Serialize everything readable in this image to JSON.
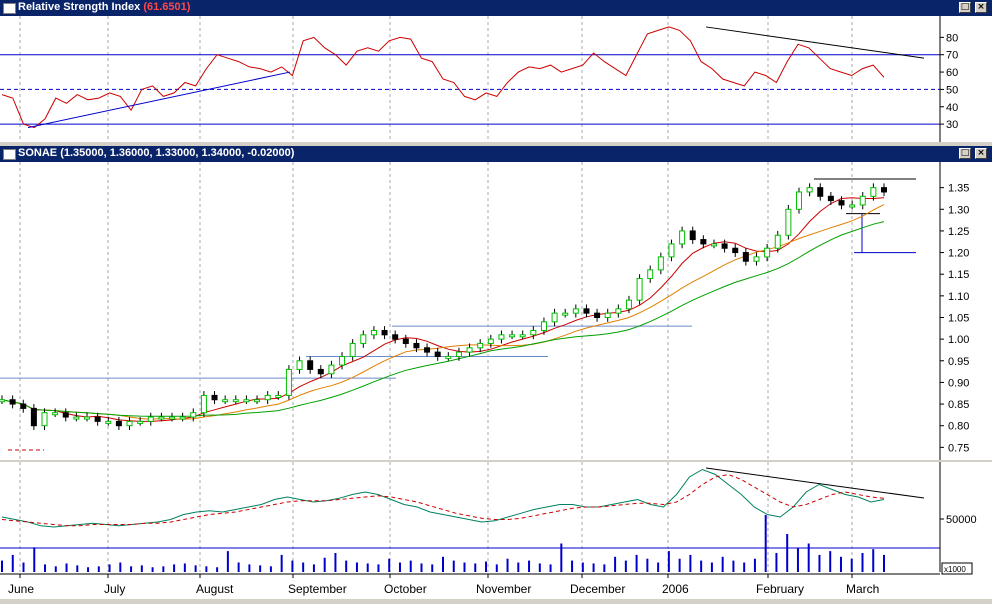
{
  "rsi_panel": {
    "title": "Relative Strength Index",
    "value": "(61.6501)",
    "ticks": [
      "80",
      "70",
      "60",
      "50",
      "40",
      "30"
    ]
  },
  "price_panel": {
    "title": "SONAE",
    "ohlc": "(1.35000, 1.36000, 1.33000, 1.34000, -0.02000)",
    "ticks": [
      "1.35",
      "1.30",
      "1.25",
      "1.20",
      "1.15",
      "1.10",
      "1.05",
      "1.00",
      "0.95",
      "0.90",
      "0.85",
      "0.80",
      "0.75"
    ]
  },
  "volume_panel": {
    "tick": "50000",
    "unit": "x1000"
  },
  "x_axis": {
    "months": [
      "June",
      "July",
      "August",
      "September",
      "October",
      "November",
      "December",
      "2006",
      "February",
      "March"
    ]
  },
  "colors": {
    "rsi_line": "#cc0000",
    "candle_up": "#00c000",
    "candle_down": "#000000",
    "ma_short": "#cc0000",
    "ma_mid": "#e08000",
    "ma_long": "#00a000",
    "volume": "#0000cc",
    "osc_fast": "#008060",
    "osc_slow": "#cc0000",
    "trendline_rsi_support": "#0000cc",
    "title_bar": "#0a246a"
  },
  "chart_data": [
    {
      "type": "line",
      "name": "rsi",
      "title": "Relative Strength Index",
      "value_label": "61.6501",
      "ylim": [
        22,
        90
      ],
      "reference_lines": [
        70,
        50,
        30
      ],
      "x": [
        "June",
        "July",
        "August",
        "September",
        "October",
        "November",
        "December",
        "2006",
        "February",
        "March"
      ],
      "series": [
        {
          "values": [
            47,
            45,
            30,
            28,
            33,
            45,
            42,
            47,
            44,
            45,
            48,
            46,
            38,
            50,
            52,
            46,
            48,
            54,
            52,
            62,
            70,
            68,
            66,
            63,
            62,
            60,
            63,
            58,
            78,
            80,
            74,
            70,
            64,
            72,
            74,
            72,
            78,
            80,
            79,
            68,
            66,
            56,
            54,
            46,
            44,
            48,
            46,
            54,
            60,
            63,
            62,
            64,
            60,
            62,
            64,
            71,
            66,
            62,
            58,
            70,
            82,
            84,
            86,
            84,
            78,
            66,
            62,
            56,
            54,
            52,
            60,
            58,
            54,
            66,
            76,
            74,
            68,
            62,
            60,
            58,
            62,
            64,
            57
          ]
        }
      ]
    },
    {
      "type": "line",
      "name": "price",
      "title": "SONAE",
      "value_label": "(1.35000, 1.36000, 1.33000, 1.34000, -0.02000)",
      "ylim": [
        0.73,
        1.4
      ],
      "x": [
        "June",
        "July",
        "August",
        "September",
        "October",
        "November",
        "December",
        "2006",
        "February",
        "March"
      ],
      "series": [
        {
          "values": [
            0.86,
            0.85,
            0.84,
            0.8,
            0.83,
            0.83,
            0.82,
            0.82,
            0.82,
            0.81,
            0.81,
            0.8,
            0.81,
            0.81,
            0.82,
            0.82,
            0.82,
            0.82,
            0.83,
            0.87,
            0.86,
            0.86,
            0.86,
            0.86,
            0.86,
            0.87,
            0.87,
            0.93,
            0.95,
            0.93,
            0.92,
            0.94,
            0.96,
            0.99,
            1.01,
            1.02,
            1.01,
            1.0,
            0.99,
            0.98,
            0.97,
            0.96,
            0.96,
            0.97,
            0.98,
            0.99,
            1.0,
            1.01,
            1.01,
            1.01,
            1.02,
            1.04,
            1.06,
            1.06,
            1.07,
            1.06,
            1.05,
            1.06,
            1.07,
            1.09,
            1.14,
            1.16,
            1.19,
            1.22,
            1.25,
            1.23,
            1.22,
            1.22,
            1.21,
            1.2,
            1.18,
            1.19,
            1.21,
            1.24,
            1.3,
            1.34,
            1.35,
            1.33,
            1.32,
            1.31,
            1.31,
            1.33,
            1.35,
            1.34
          ]
        }
      ],
      "horizontal_lines": [
        0.91,
        0.96,
        1.03,
        1.37,
        1.2
      ]
    },
    {
      "type": "bar",
      "name": "volume",
      "ytick": "50000",
      "unit": "x1000",
      "series": [
        {
          "values": [
            12,
            18,
            10,
            26,
            8,
            6,
            9,
            7,
            5,
            6,
            8,
            10,
            6,
            7,
            5,
            6,
            8,
            9,
            7,
            6,
            5,
            22,
            10,
            8,
            7,
            6,
            18,
            12,
            10,
            8,
            15,
            20,
            12,
            10,
            9,
            8,
            14,
            10,
            12,
            9,
            8,
            16,
            12,
            10,
            9,
            11,
            8,
            14,
            10,
            12,
            9,
            8,
            30,
            12,
            10,
            9,
            8,
            16,
            12,
            18,
            14,
            10,
            22,
            14,
            18,
            12,
            10,
            16,
            12,
            10,
            14,
            60,
            20,
            40,
            25,
            30,
            18,
            22,
            16,
            14,
            20,
            24,
            18
          ]
        }
      ]
    },
    {
      "type": "line",
      "name": "volume_oscillator",
      "series": [
        {
          "values": [
            52,
            50,
            48,
            45,
            44,
            45,
            46,
            47,
            46,
            45,
            46,
            47,
            48,
            50,
            54,
            56,
            57,
            56,
            58,
            60,
            62,
            66,
            68,
            66,
            64,
            65,
            67,
            70,
            72,
            70,
            66,
            62,
            60,
            56,
            54,
            52,
            50,
            48,
            49,
            52,
            55,
            58,
            60,
            62,
            62,
            60,
            60,
            62,
            64,
            66,
            62,
            60,
            70,
            84,
            90,
            86,
            78,
            70,
            60,
            54,
            52,
            60,
            72,
            78,
            74,
            70,
            68,
            64,
            66
          ]
        },
        {
          "values": [
            50,
            49,
            48,
            47,
            46,
            45,
            45,
            46,
            46,
            46,
            46,
            47,
            47,
            48,
            50,
            52,
            54,
            55,
            56,
            58,
            60,
            62,
            64,
            65,
            65,
            65,
            66,
            67,
            68,
            69,
            68,
            66,
            64,
            61,
            58,
            55,
            53,
            51,
            50,
            50,
            51,
            53,
            55,
            57,
            59,
            60,
            60,
            61,
            62,
            63,
            63,
            62,
            64,
            70,
            78,
            84,
            86,
            82,
            76,
            70,
            64,
            60,
            62,
            66,
            70,
            72,
            70,
            68,
            67
          ]
        }
      ]
    }
  ]
}
